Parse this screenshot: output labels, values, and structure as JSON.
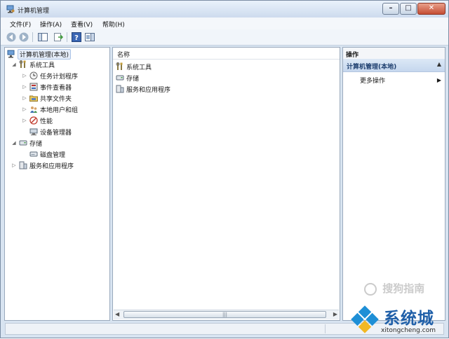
{
  "window": {
    "title": "计算机管理"
  },
  "menubar": {
    "items": [
      "文件(F)",
      "操作(A)",
      "查看(V)",
      "帮助(H)"
    ]
  },
  "tree": {
    "root": "计算机管理(本地)",
    "system_tools": "系统工具",
    "task_scheduler": "任务计划程序",
    "event_viewer": "事件查看器",
    "shared_folders": "共享文件夹",
    "local_users": "本地用户和组",
    "performance": "性能",
    "device_manager": "设备管理器",
    "storage": "存储",
    "disk_management": "磁盘管理",
    "services_apps": "服务和应用程序"
  },
  "content": {
    "column_name": "名称",
    "items": [
      "系统工具",
      "存储",
      "服务和应用程序"
    ],
    "scroll_marker": "|||"
  },
  "actions": {
    "header": "操作",
    "section": "计算机管理(本地)",
    "more": "更多操作"
  },
  "watermark": {
    "sogou": "搜狗指南",
    "brand": "系统城",
    "url": "xitongcheng.com"
  }
}
